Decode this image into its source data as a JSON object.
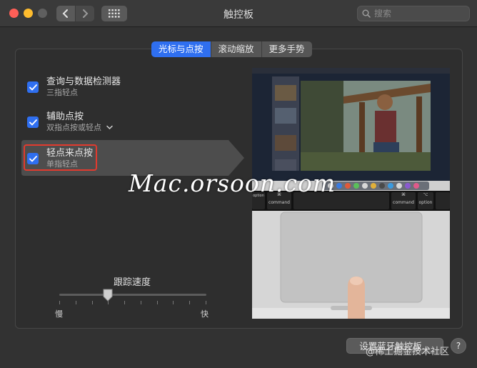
{
  "window": {
    "title": "触控板"
  },
  "search": {
    "placeholder": "搜索"
  },
  "tabs": [
    {
      "label": "光标与点按",
      "active": true
    },
    {
      "label": "滚动缩放",
      "active": false
    },
    {
      "label": "更多手势",
      "active": false
    }
  ],
  "options": [
    {
      "title": "查询与数据检测器",
      "subtitle": "三指轻点",
      "checked": true
    },
    {
      "title": "辅助点按",
      "subtitle": "双指点按或轻点",
      "checked": true
    },
    {
      "title": "轻点来点按",
      "subtitle": "单指轻点",
      "checked": true,
      "selected": true
    }
  ],
  "tracking": {
    "label": "跟踪速度",
    "min_label": "慢",
    "max_label": "快",
    "value_fraction": 0.33
  },
  "preview": {
    "keys": [
      {
        "top": "⌘",
        "bottom": "command"
      },
      {
        "top": "⌘",
        "bottom": "command"
      },
      {
        "top": "⌥",
        "bottom": "option"
      }
    ],
    "left_key_label": "option"
  },
  "watermark": "Mac.orsoon.com",
  "footer": {
    "bluetooth_button": "设置蓝牙触控板...",
    "help": "?",
    "credit": "@稀土掘金技术社区"
  },
  "colors": {
    "accent": "#2f6ff0",
    "highlight_box": "#e23a2e"
  }
}
